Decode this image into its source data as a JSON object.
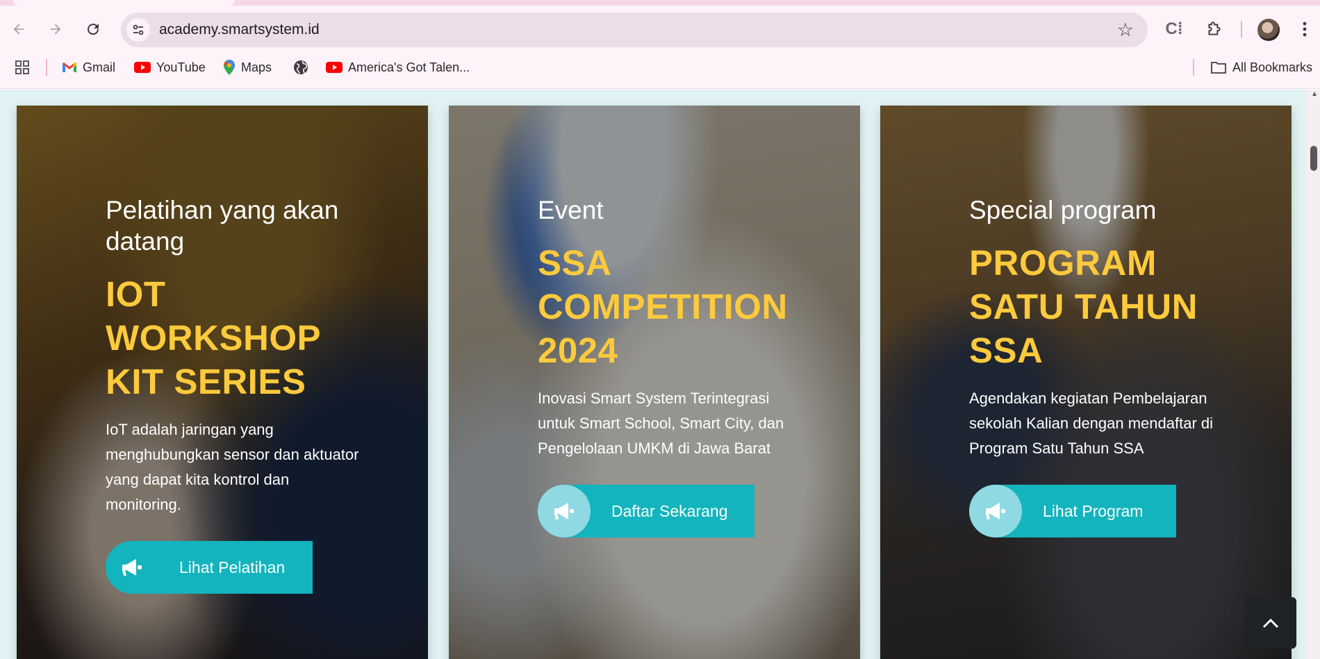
{
  "browser": {
    "url": "academy.smartsystem.id",
    "bookmarks": [
      {
        "label": "Gmail",
        "icon": "gmail-icon"
      },
      {
        "label": "YouTube",
        "icon": "youtube-icon"
      },
      {
        "label": "Maps",
        "icon": "maps-icon"
      },
      {
        "label": "",
        "icon": "globe-icon"
      },
      {
        "label": "America's Got Talen...",
        "icon": "youtube-icon"
      }
    ],
    "all_bookmarks_label": "All Bookmarks",
    "chrome_color": "#fdf3f8"
  },
  "cards": [
    {
      "subtitle": "Pelatihan yang akan datang",
      "title": "IOT WORKSHOP KIT SERIES",
      "description": "IoT adalah jaringan yang menghubungkan sensor dan aktuator yang dapat kita kontrol dan monitoring.",
      "button_label": "Lihat Pelatihan",
      "button_icon": "megaphone-icon"
    },
    {
      "subtitle": "Event",
      "title": "SSA COMPETITION 2024",
      "description": "Inovasi Smart System Terintegrasi untuk Smart School, Smart City, dan Pengelolaan UMKM di Jawa Barat",
      "button_label": "Daftar Sekarang",
      "button_icon": "megaphone-icon"
    },
    {
      "subtitle": "Special program",
      "title": "PROGRAM SATU TAHUN SSA",
      "description": "Agendakan kegiatan Pembelajaran sekolah Kalian dengan mendaftar di Program Satu Tahun SSA",
      "button_label": "Lihat Program",
      "button_icon": "megaphone-icon"
    }
  ],
  "colors": {
    "title_yellow": "#fcca3c",
    "button_teal": "#13b4bd",
    "page_bg": "#e0f2f3"
  }
}
